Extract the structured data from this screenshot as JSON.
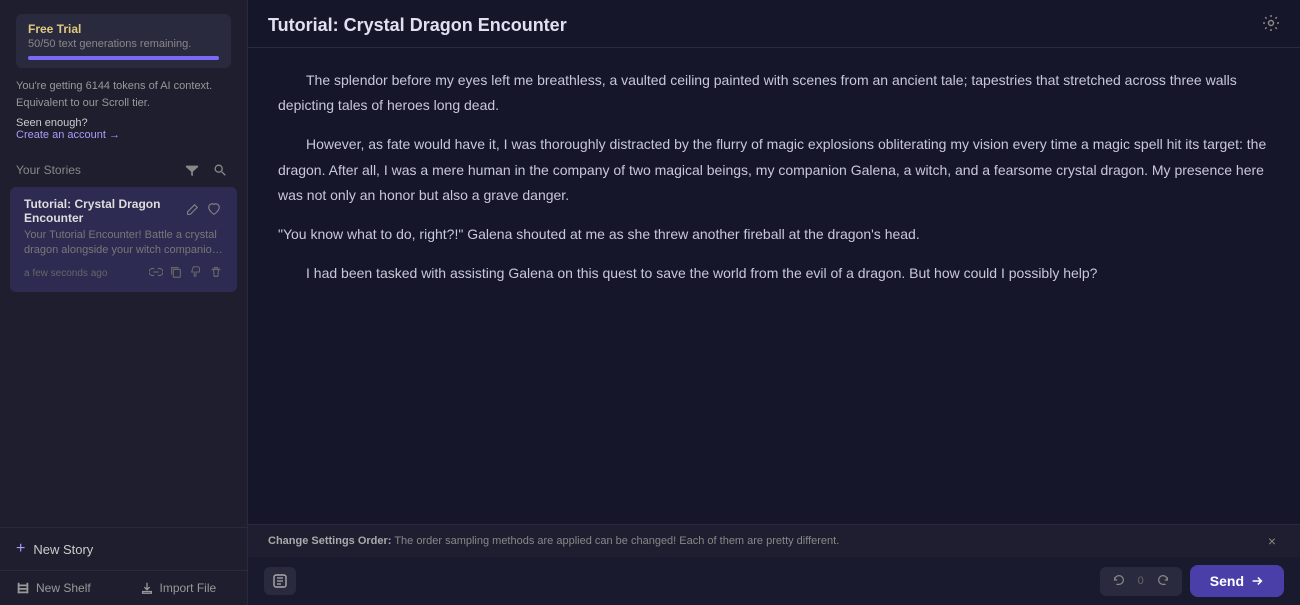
{
  "sidebar": {
    "free_trial_label": "Free Trial",
    "generations_text": "50/50 text generations remaining.",
    "tokens_line1": "You're getting 6144 tokens of AI context.",
    "tokens_line2": "Equivalent to our Scroll tier.",
    "seen_enough": "Seen enough?",
    "create_account_text": "Create an account",
    "create_account_arrow": "→",
    "your_stories_label": "Your Stories",
    "story": {
      "title": "Tutorial: Crystal Dragon Encounter",
      "excerpt": "Your Tutorial Encounter! Battle a crystal dragon alongside your witch companion Galena while you lear...",
      "time": "a few seconds ago"
    },
    "new_story_label": "New Story",
    "new_story_plus": "+",
    "new_shelf_label": "New Shelf",
    "import_file_label": "Import File"
  },
  "main": {
    "title": "Tutorial: Crystal Dragon Encounter",
    "paragraphs": [
      "The splendor before my eyes left me breathless, a vaulted ceiling painted with scenes from an ancient tale; tapestries that stretched across three walls depicting tales of heroes long dead.",
      "However, as fate would have it, I was thoroughly distracted by the flurry of magic explosions obliterating my vision every time a magic spell hit its target: the dragon. After all, I was a mere human in the company of two magical beings, my companion Galena, a witch, and a fearsome crystal dragon. My presence here was not only an honor but also a grave danger.",
      "\"You know what to do, right?!\" Galena shouted at me as she threw another fireball at the dragon's head.",
      "I had been tasked with assisting Galena on this quest to save the world from the evil of a dragon. But how could I possibly help?"
    ],
    "notification": {
      "prefix": "Change Settings Order:",
      "text": "The order sampling methods are applied can be changed! Each of them are pretty different.",
      "close_icon": "×"
    },
    "toolbar": {
      "send_label": "Send",
      "send_arrow": "→",
      "undo_count": "0"
    }
  },
  "icons": {
    "filter": "⚙",
    "search": "🔍",
    "edit": "✏",
    "heart": "♡",
    "link": "🔗",
    "copy": "⎘",
    "thumbdown": "👎",
    "trash": "🗑",
    "plus": "+",
    "shelf": "📚",
    "import": "↑",
    "settings": "⚙",
    "undo": "↺",
    "redo": "↻"
  }
}
